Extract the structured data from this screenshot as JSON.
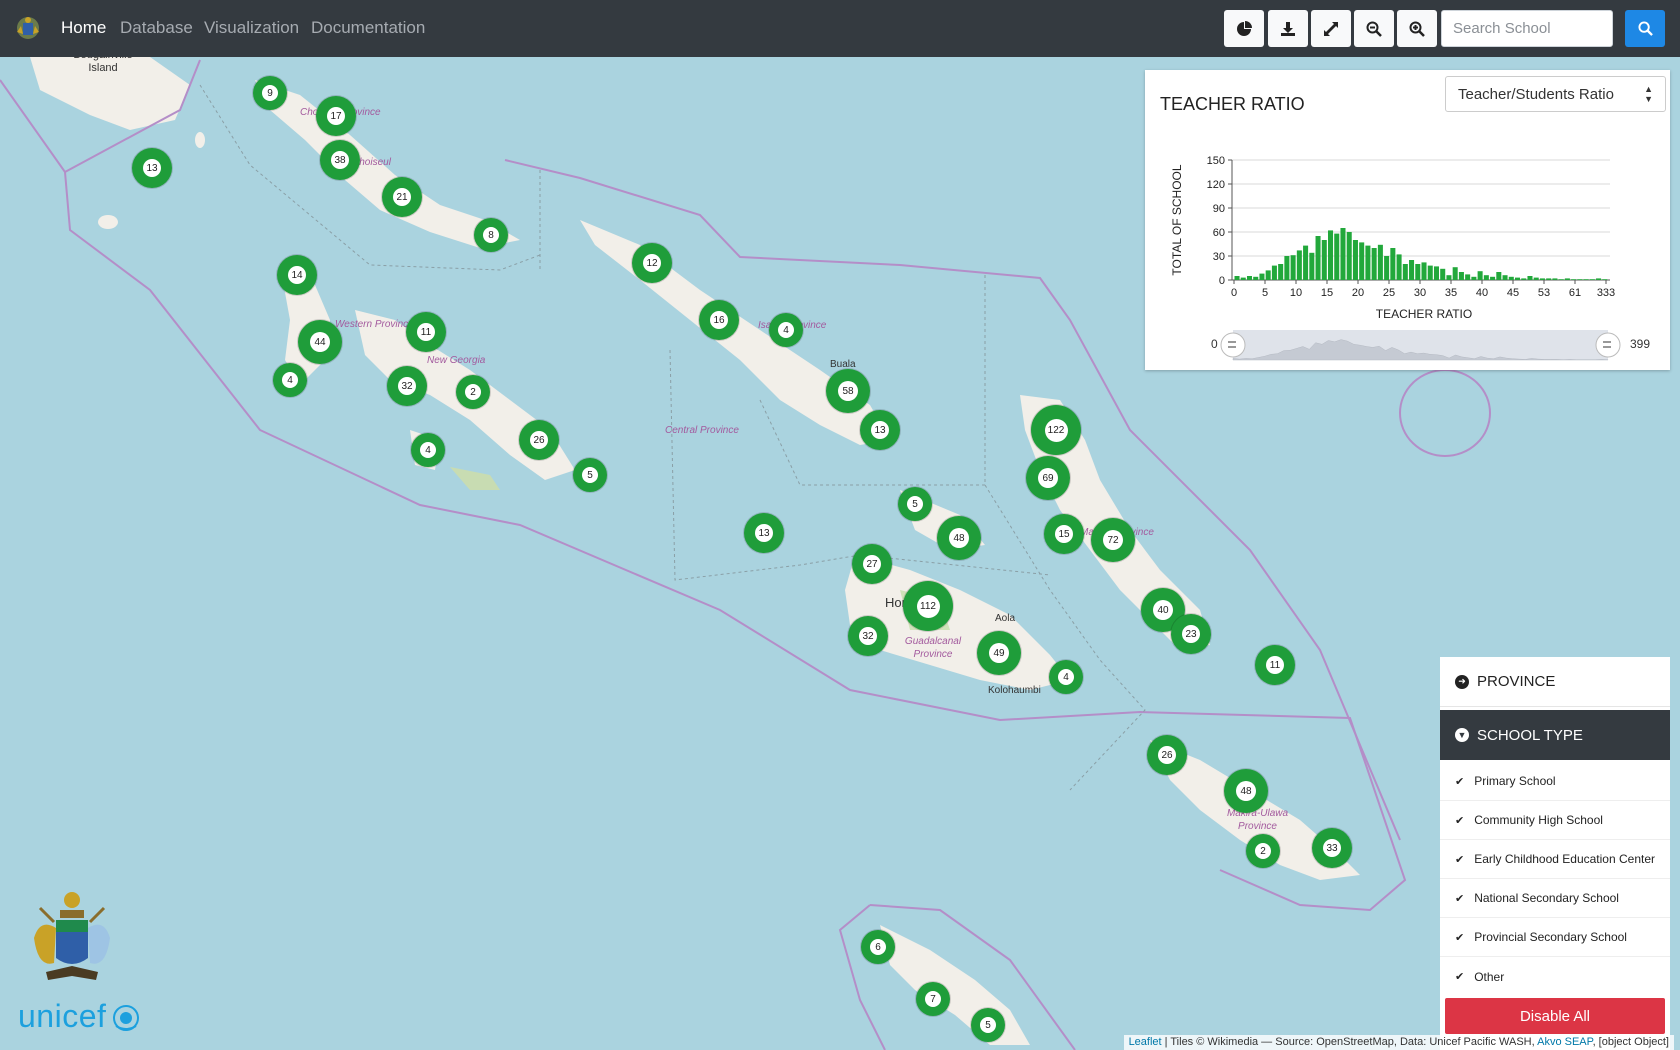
{
  "nav": {
    "items": [
      {
        "label": "Home",
        "active": true
      },
      {
        "label": "Database",
        "active": false
      },
      {
        "label": "Visualization",
        "active": false
      },
      {
        "label": "Documentation",
        "active": false
      }
    ]
  },
  "toolbar": {
    "icons": [
      "pie-chart-icon",
      "download-icon",
      "fullscreen-icon",
      "zoom-out-icon",
      "zoom-in-icon"
    ],
    "search_placeholder": "Search School",
    "search_icon": "search-icon"
  },
  "map": {
    "labels": {
      "bougainville": "Bougainville Island",
      "choiseul_province": "Choiseul Province",
      "choiseul": "Choiseul",
      "western_province": "Western Province",
      "new_georgia": "New Georgia",
      "isabel_province": "Isabel Province",
      "buala": "Buala",
      "central_province": "Central Province",
      "malaita_province": "Malaita Province",
      "honiara": "Honiara",
      "aola": "Aola",
      "guadalcanal_province": "Guadalcanal Province",
      "kolohaumbi": "Kolohaumbi",
      "makira_province": "Makira-Ulawa Province"
    },
    "clusters": [
      "9",
      "17",
      "38",
      "13",
      "21",
      "8",
      "14",
      "44",
      "11",
      "4",
      "32",
      "2",
      "26",
      "4",
      "5",
      "12",
      "16",
      "4",
      "58",
      "13",
      "122",
      "69",
      "15",
      "72",
      "5",
      "48",
      "13",
      "27",
      "112",
      "32",
      "49",
      "4",
      "40",
      "23",
      "11",
      "26",
      "48",
      "2",
      "33",
      "6",
      "7",
      "5"
    ]
  },
  "chart_panel": {
    "title": "TEACHER RATIO",
    "select_value": "Teacher/Students Ratio",
    "range_min": "0",
    "range_max": "399"
  },
  "chart_data": {
    "type": "bar",
    "title": "TEACHER RATIO",
    "xlabel": "TEACHER RATIO",
    "ylabel": "TOTAL OF SCHOOL",
    "ylim": [
      0,
      150
    ],
    "yticks": [
      "0",
      "30",
      "60",
      "90",
      "120",
      "150"
    ],
    "xticks": [
      "0",
      "5",
      "10",
      "15",
      "20",
      "25",
      "30",
      "35",
      "40",
      "45",
      "53",
      "61",
      "333"
    ],
    "grid": true,
    "values": [
      5,
      3,
      5,
      4,
      8,
      12,
      18,
      20,
      30,
      31,
      37,
      43,
      34,
      55,
      50,
      62,
      58,
      65,
      60,
      50,
      47,
      43,
      40,
      44,
      30,
      40,
      32,
      20,
      25,
      20,
      22,
      18,
      17,
      14,
      6,
      16,
      10,
      7,
      4,
      11,
      6,
      4,
      10,
      6,
      4,
      3,
      2,
      5,
      3,
      2,
      2,
      2,
      1,
      2,
      1,
      1,
      1,
      1,
      2,
      1
    ]
  },
  "filters": {
    "province_label": "PROVINCE",
    "school_type_label": "SCHOOL TYPE",
    "items": [
      {
        "label": "Primary School"
      },
      {
        "label": "Community High School"
      },
      {
        "label": "Early Childhood Education Center"
      },
      {
        "label": "National Secondary School"
      },
      {
        "label": "Provincial Secondary School"
      },
      {
        "label": "Other"
      }
    ],
    "disable_all": "Disable All"
  },
  "logos": {
    "unicef": "unicef"
  },
  "attribution": {
    "leaflet": "Leaflet",
    "text1": " | Tiles © Wikimedia — Source: OpenStreetMap, Data: Unicef Pacific WASH, ",
    "akvo": "Akvo SEAP",
    "text2": ", [object Object]"
  },
  "colors": {
    "navbar": "#343a40",
    "cluster": "#1f9d3a",
    "bar": "#22a83b",
    "sea": "#aad3df",
    "land": "#f2efe9",
    "danger": "#dc3545",
    "primary": "#1e88e5"
  }
}
